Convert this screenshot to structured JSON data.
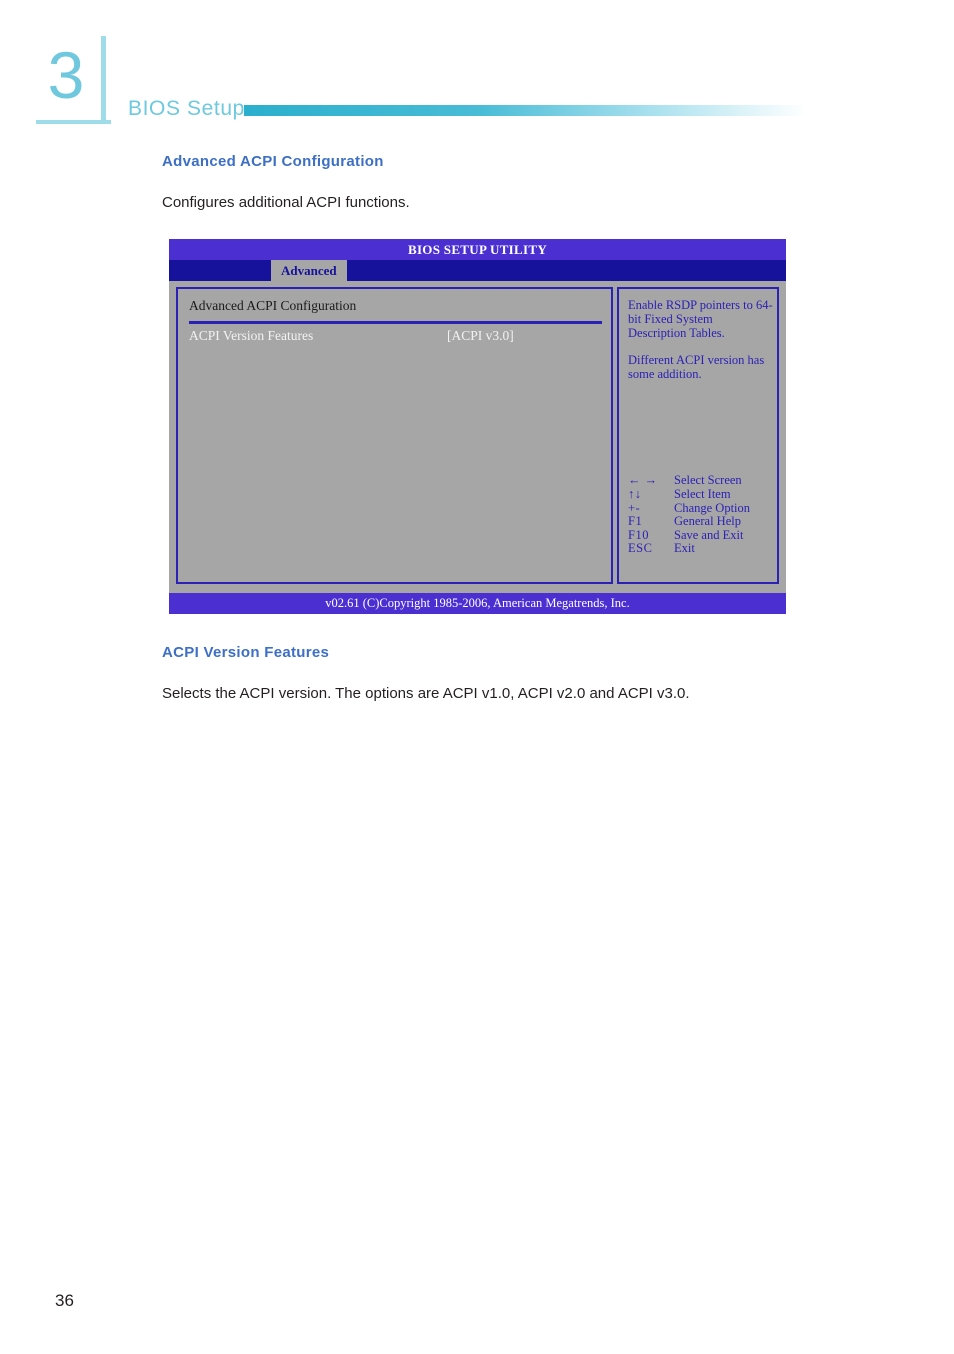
{
  "chapter": {
    "number": "3",
    "title": "BIOS Setup"
  },
  "page": {
    "number": "36"
  },
  "sections": [
    {
      "heading": "Advanced ACPI Configuration",
      "paragraph": "Configures additional ACPI functions."
    },
    {
      "heading": "ACPI Version Features",
      "paragraph": "Selects the ACPI version. The options are ACPI v1.0, ACPI v2.0 and ACPI v3.0."
    }
  ],
  "bios": {
    "title": "BIOS SETUP UTILITY",
    "active_tab": "Advanced",
    "group_title": "Advanced ACPI Configuration",
    "settings": [
      {
        "label": "ACPI Version Features",
        "value": "[ACPI v3.0]"
      }
    ],
    "help": {
      "paragraphs": [
        "Enable RSDP pointers to 64-bit Fixed System Description Tables.",
        "Different ACPI version has some addition."
      ]
    },
    "legend": [
      {
        "key": "← →",
        "action": "Select Screen"
      },
      {
        "key": "↑↓",
        "action": "Select Item"
      },
      {
        "key": "+-",
        "action": "Change Option"
      },
      {
        "key": "F1",
        "action": "General Help"
      },
      {
        "key": "F10",
        "action": "Save and Exit"
      },
      {
        "key": "ESC",
        "action": "Exit"
      }
    ],
    "footer": "v02.61 (C)Copyright 1985-2006, American Megatrends, Inc."
  }
}
